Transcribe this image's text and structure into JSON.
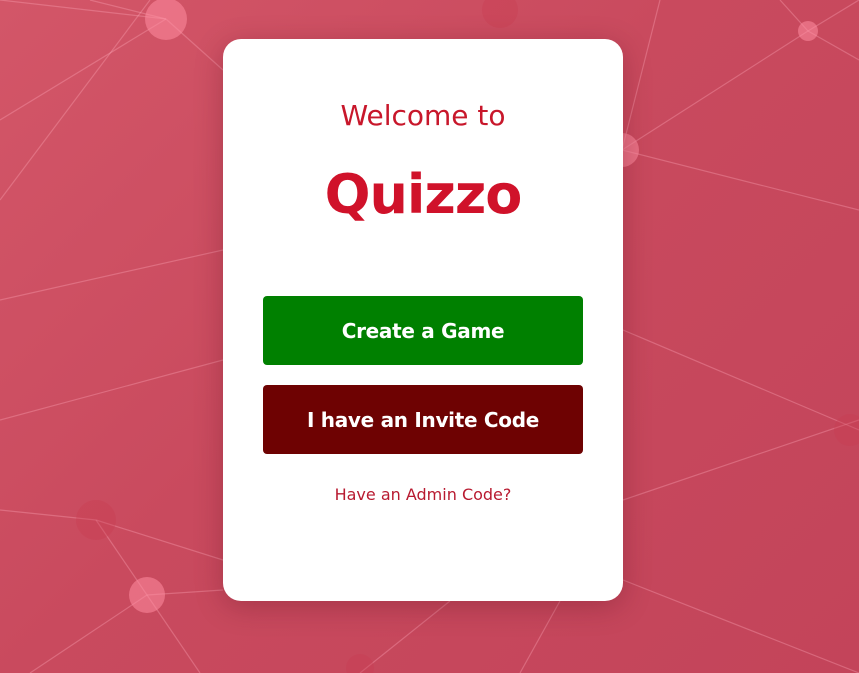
{
  "background": {
    "colors": [
      "#d35668",
      "#c3445a"
    ],
    "pattern": "network-nodes"
  },
  "card": {
    "welcome_text": "Welcome to",
    "app_name": "Quizzo",
    "create_button_label": "Create a Game",
    "invite_button_label": "I have an Invite Code",
    "admin_link_label": "Have an Admin Code?"
  },
  "colors": {
    "accent": "#d0122a",
    "create_button": "#008000",
    "invite_button": "#6e0202",
    "card_bg": "#ffffff"
  }
}
